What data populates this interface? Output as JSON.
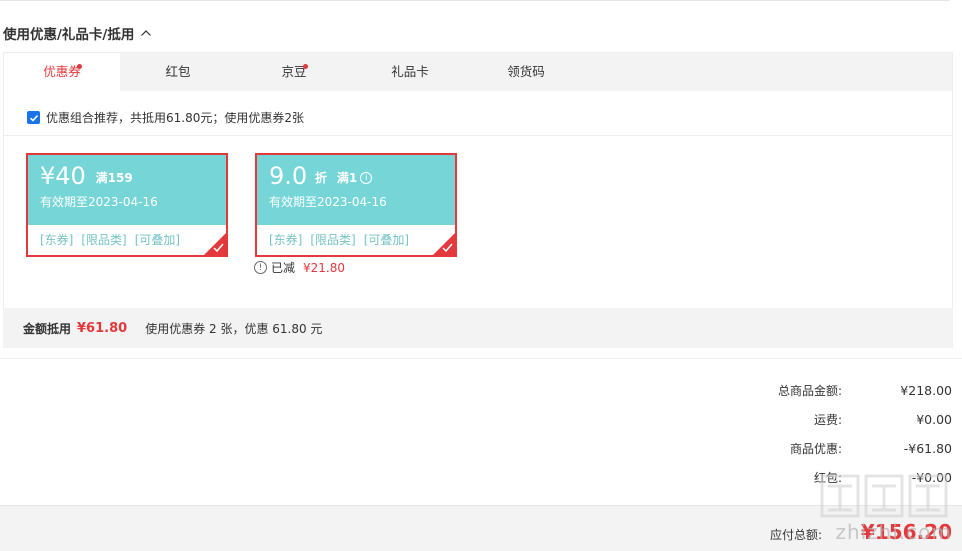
{
  "section": {
    "title": "使用优惠/礼品卡/抵用"
  },
  "tabs": [
    {
      "label": "优惠券",
      "active": true,
      "dot": true
    },
    {
      "label": "红包",
      "active": false,
      "dot": false
    },
    {
      "label": "京豆",
      "active": false,
      "dot": true
    },
    {
      "label": "礼品卡",
      "active": false,
      "dot": false
    },
    {
      "label": "领货码",
      "active": false,
      "dot": false
    }
  ],
  "combo": {
    "checked": true,
    "text": "优惠组合推荐，共抵用61.80元；使用优惠券2张"
  },
  "coupons": [
    {
      "amount": "¥40",
      "condition": "满159",
      "valid": "有效期至2023-04-16",
      "tags": [
        "[东券]",
        "[限品类]",
        "[可叠加]"
      ],
      "selected": true
    },
    {
      "amount": "9.0",
      "unit": "折",
      "condition": "满1",
      "valid": "有效期至2023-04-16",
      "tags": [
        "[东券]",
        "[限品类]",
        "[可叠加]"
      ],
      "selected": true
    }
  ],
  "reduced": {
    "label": "已减",
    "amount": "¥21.80"
  },
  "summary": {
    "label": "金额抵用",
    "value": "¥61.80",
    "desc": "使用优惠券 2 张，优惠 61.80 元"
  },
  "totals": [
    {
      "label": "总商品金额:",
      "value": "¥218.00"
    },
    {
      "label": "运费:",
      "value": "¥0.00"
    },
    {
      "label": "商品优惠:",
      "value": "-¥61.80"
    },
    {
      "label": "红包:",
      "value": "-¥0.00"
    }
  ],
  "pay": {
    "label": "应付总额:",
    "value": "¥156.20"
  },
  "watermark": "zhizhi.com",
  "colors": {
    "accent": "#e4393c",
    "coupon": "#76d5d7",
    "tag": "#76c3c6"
  }
}
